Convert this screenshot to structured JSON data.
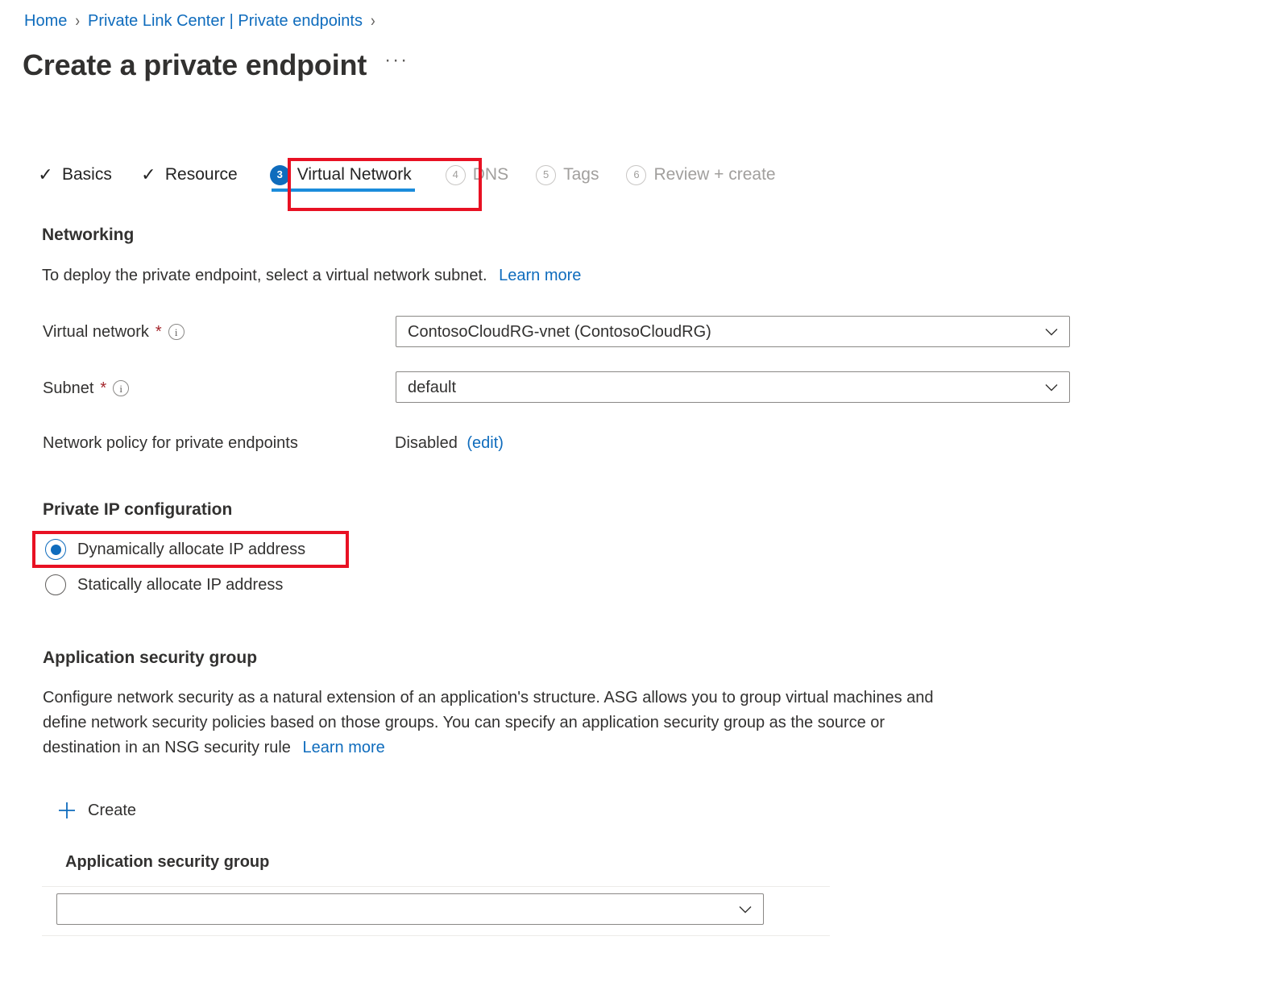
{
  "breadcrumb": {
    "items": [
      {
        "label": "Home"
      },
      {
        "label": "Private Link Center | Private endpoints"
      }
    ],
    "separator": "›"
  },
  "header": {
    "title": "Create a private endpoint",
    "more_label": "···"
  },
  "wizard": {
    "tabs": [
      {
        "label": "Basics",
        "state": "done",
        "icon": "check-icon",
        "check": "✓"
      },
      {
        "label": "Resource",
        "state": "done",
        "icon": "check-icon",
        "check": "✓"
      },
      {
        "label": "Virtual Network",
        "state": "active",
        "step": "3"
      },
      {
        "label": "DNS",
        "state": "disabled",
        "step": "4"
      },
      {
        "label": "Tags",
        "state": "disabled",
        "step": "5"
      },
      {
        "label": "Review + create",
        "state": "disabled",
        "step": "6"
      }
    ]
  },
  "networking": {
    "heading": "Networking",
    "description": "To deploy the private endpoint, select a virtual network subnet.",
    "learn_more": "Learn more",
    "virtual_network": {
      "label": "Virtual network",
      "required_mark": "*",
      "value": "ContosoCloudRG-vnet (ContosoCloudRG)"
    },
    "subnet": {
      "label": "Subnet",
      "required_mark": "*",
      "value": "default"
    },
    "network_policy": {
      "label": "Network policy for private endpoints",
      "value": "Disabled",
      "edit_link": "(edit)"
    }
  },
  "private_ip": {
    "heading": "Private IP configuration",
    "options": [
      {
        "label": "Dynamically allocate IP address",
        "selected": true
      },
      {
        "label": "Statically allocate IP address",
        "selected": false
      }
    ]
  },
  "asg": {
    "heading": "Application security group",
    "description_line1": "Configure network security as a natural extension of an application's structure. ASG allows you to group virtual machines and",
    "description_line2": "define network security policies based on those groups. You can specify an application security group as the source or",
    "description_line3": "destination in an NSG security rule",
    "learn_more": "Learn more",
    "create_label": "Create",
    "column_header": "Application security group",
    "selector_value": ""
  },
  "colors": {
    "accent": "#0f6cbd",
    "link": "#0f6cbd",
    "annotation": "#e81123",
    "required": "#a4262c",
    "disabled_text": "#a19f9d",
    "underline": "#1b8cdb"
  }
}
